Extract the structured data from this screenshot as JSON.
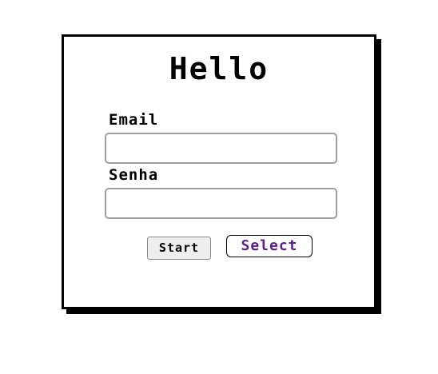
{
  "form": {
    "title": "Hello",
    "email_label": "Email",
    "email_value": "",
    "password_label": "Senha",
    "password_value": "",
    "start_label": "Start",
    "select_label": "Select"
  },
  "colors": {
    "select_text": "#5a1e8c",
    "border": "#000000"
  }
}
